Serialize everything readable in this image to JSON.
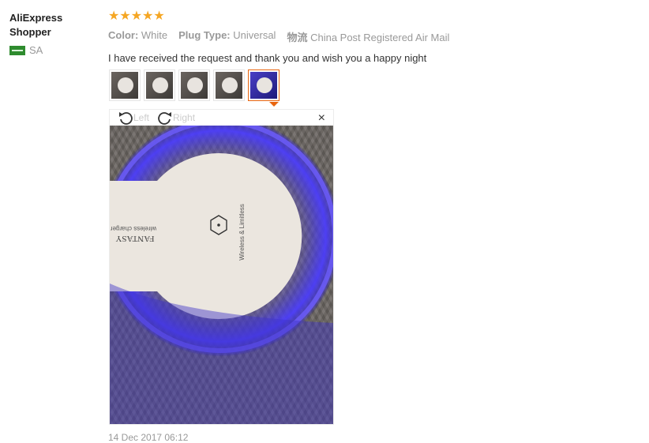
{
  "user": {
    "name": "AliExpress Shopper",
    "country": "SA"
  },
  "review": {
    "stars": "★★★★★",
    "meta": [
      {
        "label": "Color:",
        "value": "White"
      },
      {
        "label": "Plug Type:",
        "value": "Universal"
      },
      {
        "label": "物流",
        "value": "China Post Registered Air Mail"
      }
    ],
    "text": "I have received the request and thank you and wish you a happy night",
    "date": "14 Dec 2017 06:12"
  },
  "viewer": {
    "rotate_left": "Left",
    "rotate_right": "Right",
    "close": "×",
    "photo_text": {
      "brand": "FANTASY",
      "product": "wireless charger",
      "tagline": "Wireless & Limitless"
    }
  },
  "colors": {
    "star": "#f5a623",
    "active_border": "#e8650f"
  }
}
